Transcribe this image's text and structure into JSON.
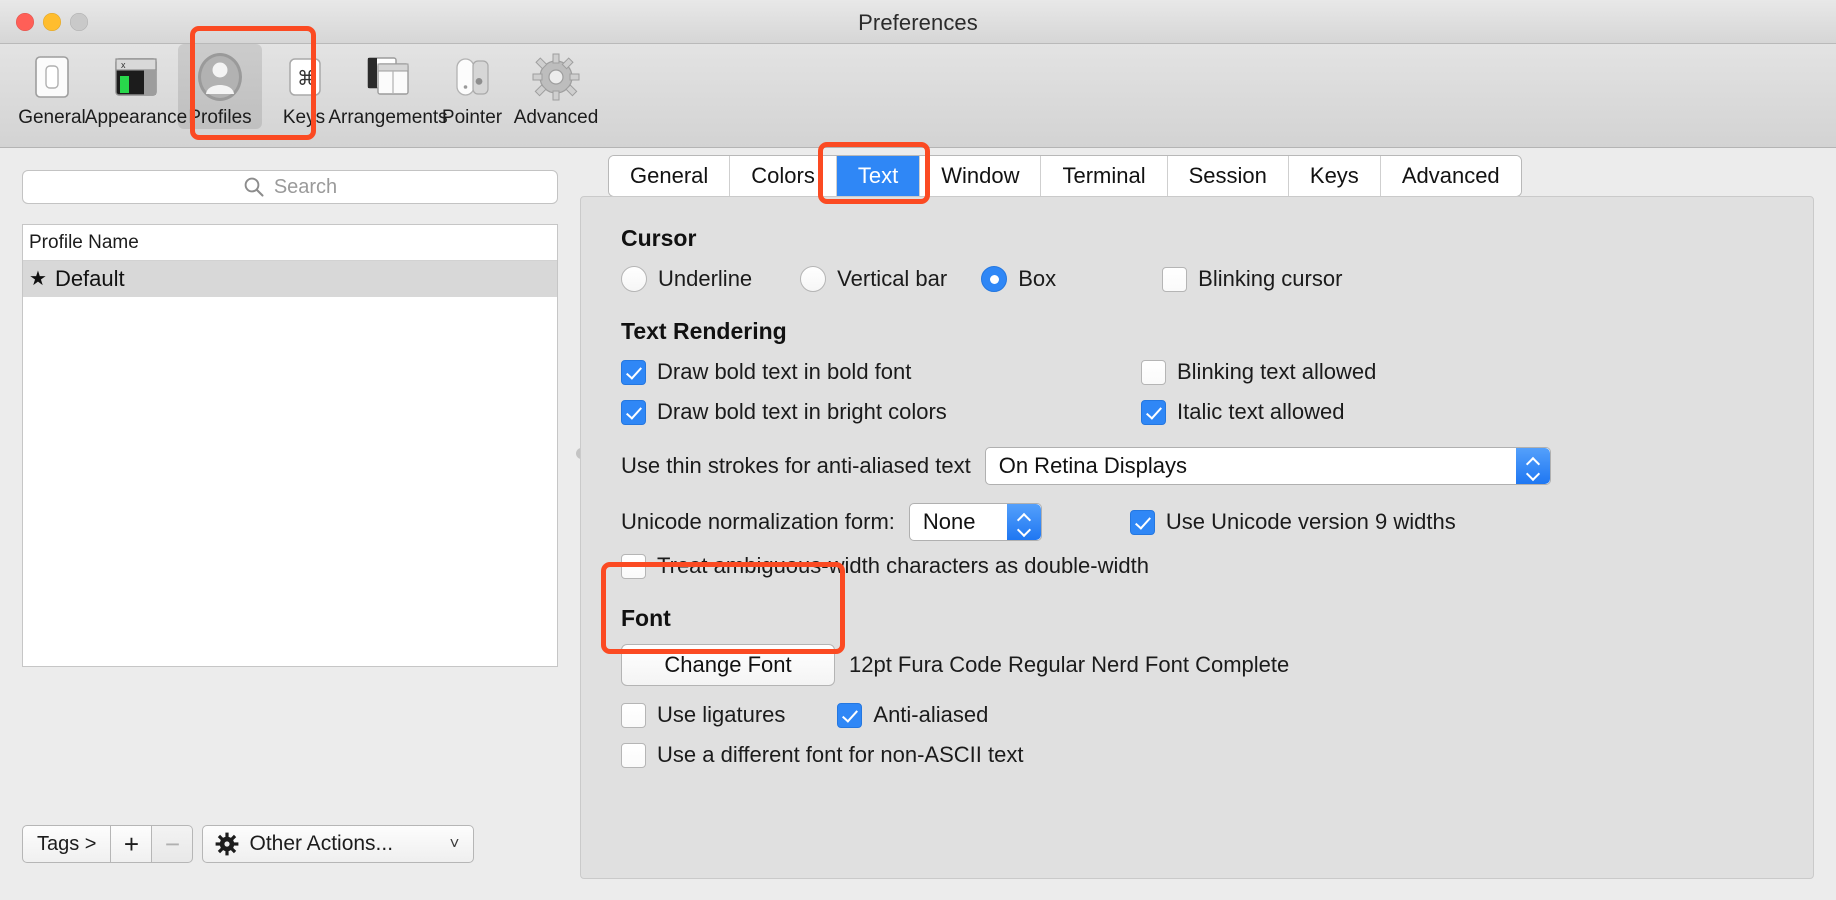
{
  "window": {
    "title": "Preferences",
    "traffic_lights": [
      "close",
      "minimize",
      "zoom"
    ]
  },
  "toolbar": {
    "items": [
      {
        "label": "General",
        "icon": "general-icon",
        "selected": false
      },
      {
        "label": "Appearance",
        "icon": "appearance-icon",
        "selected": false
      },
      {
        "label": "Profiles",
        "icon": "profiles-icon",
        "selected": true
      },
      {
        "label": "Keys",
        "icon": "keys-icon",
        "selected": false
      },
      {
        "label": "Arrangements",
        "icon": "arrangements-icon",
        "selected": false
      },
      {
        "label": "Pointer",
        "icon": "pointer-icon",
        "selected": false
      },
      {
        "label": "Advanced",
        "icon": "advanced-icon",
        "selected": false
      }
    ]
  },
  "sidebar": {
    "search": {
      "placeholder": "Search",
      "value": "",
      "icon": "search-icon"
    },
    "list": {
      "column_header": "Profile Name",
      "rows": [
        {
          "star": "★",
          "name": "Default",
          "selected": true
        }
      ]
    },
    "bottom_bar": {
      "tags_label": "Tags >",
      "add_label": "+",
      "remove_label": "−",
      "other_actions_label": "Other Actions...",
      "other_actions_icon": "gear-icon",
      "chevron": "˅"
    }
  },
  "tabs": [
    {
      "label": "General",
      "active": false
    },
    {
      "label": "Colors",
      "active": false
    },
    {
      "label": "Text",
      "active": true
    },
    {
      "label": "Window",
      "active": false
    },
    {
      "label": "Terminal",
      "active": false
    },
    {
      "label": "Session",
      "active": false
    },
    {
      "label": "Keys",
      "active": false
    },
    {
      "label": "Advanced",
      "active": false
    }
  ],
  "cursor": {
    "title": "Cursor",
    "options": [
      {
        "label": "Underline",
        "selected": false
      },
      {
        "label": "Vertical bar",
        "selected": false
      },
      {
        "label": "Box",
        "selected": true
      }
    ],
    "blinking": {
      "label": "Blinking cursor",
      "checked": false
    }
  },
  "text_rendering": {
    "title": "Text Rendering",
    "bold_in_bold_font": {
      "label": "Draw bold text in bold font",
      "checked": true
    },
    "bold_in_bright": {
      "label": "Draw bold text in bright colors",
      "checked": true
    },
    "blinking_text": {
      "label": "Blinking text allowed",
      "checked": false
    },
    "italic_text": {
      "label": "Italic text allowed",
      "checked": true
    },
    "thin_strokes": {
      "label": "Use thin strokes for anti-aliased text",
      "value": "On Retina Displays"
    },
    "unicode_norm": {
      "label": "Unicode normalization form:",
      "value": "None"
    },
    "unicode9": {
      "label": "Use Unicode version 9 widths",
      "checked": true
    },
    "ambiguous_width": {
      "label": "Treat ambiguous-width characters as double-width",
      "checked": false
    }
  },
  "font": {
    "title": "Font",
    "change_font_button": "Change Font",
    "current_font": "12pt Fura Code Regular Nerd Font Complete",
    "ligatures": {
      "label": "Use ligatures",
      "checked": false
    },
    "antialiased": {
      "label": "Anti-aliased",
      "checked": true
    },
    "non_ascii": {
      "label": "Use a different font for non-ASCII text",
      "checked": false
    }
  },
  "annotations": {
    "highlight_color": "#fb4a22",
    "boxes": [
      "profiles-toolbar-item",
      "text-tab",
      "font-section"
    ]
  },
  "colors": {
    "accent_blue": "#2f87f6",
    "window_bg": "#ececec",
    "panel_bg": "#e0e0e0"
  }
}
